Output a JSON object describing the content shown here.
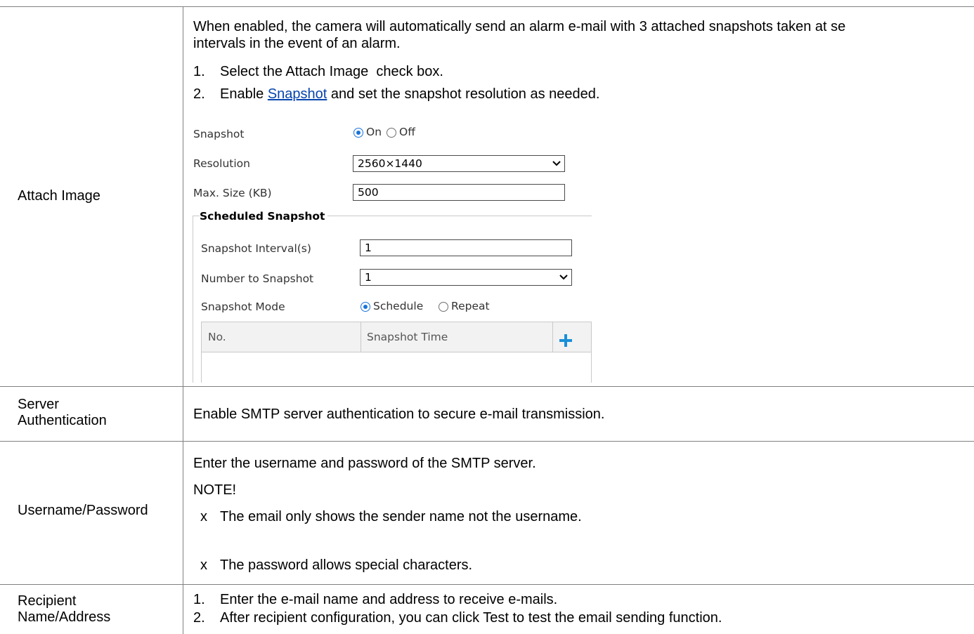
{
  "rows": {
    "attach_image": {
      "label": "Attach Image",
      "desc_line1": "When enabled, the camera will automatically send an alarm e-mail with 3 attached snapshots taken at se",
      "desc_line2": "intervals in the event of an alarm.",
      "step1_num": "1.",
      "step1_text": "Select the Attach Image  check box.",
      "step2_num": "2.",
      "step2_pre": "Enable ",
      "step2_link": "Snapshot",
      "step2_post": " and set the snapshot resolution as needed."
    },
    "server_auth": {
      "label_line1": "Server",
      "label_line2": "Authentication",
      "text": "Enable SMTP server authentication to secure e-mail transmission."
    },
    "username_password": {
      "label": "Username/Password",
      "text": "Enter the username and password of the SMTP server.",
      "note": "NOTE!",
      "bullet_char": "x",
      "bullet1": "The email only shows the sender name not the username.",
      "bullet2": "The password allows special characters."
    },
    "recipient": {
      "label_line1": "Recipient",
      "label_line2": "Name/Address",
      "step1_num": "1.",
      "step1_text": "Enter the e-mail name and address to receive e-mails.",
      "step2_num": "2.",
      "step2_text": "After recipient configuration, you can click Test to test the email sending function."
    }
  },
  "snapshot_panel": {
    "snapshot_label": "Snapshot",
    "on_label": "On",
    "off_label": "Off",
    "snapshot_selected": "On",
    "resolution_label": "Resolution",
    "resolution_value": "2560×1440",
    "max_size_label": "Max. Size (KB)",
    "max_size_value": "500",
    "scheduled_title": "Scheduled Snapshot",
    "interval_label": "Snapshot Interval(s)",
    "interval_value": "1",
    "number_label": "Number to Snapshot",
    "number_value": "1",
    "mode_label": "Snapshot Mode",
    "schedule_label": "Schedule",
    "repeat_label": "Repeat",
    "mode_selected": "Schedule",
    "table_col_no": "No.",
    "table_col_time": "Snapshot Time",
    "radio_color": "#1a73d9",
    "add_icon_color": "#1a8fd8"
  },
  "colors": {
    "link": "#0645ad",
    "rule": "#808080"
  }
}
